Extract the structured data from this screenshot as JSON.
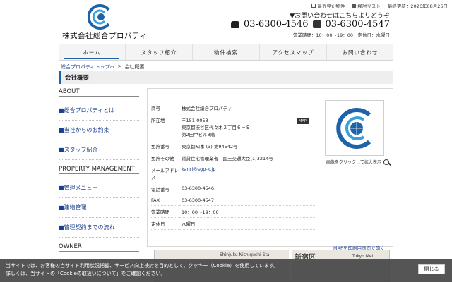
{
  "header": {
    "site_name": "株式会社総合プロパティ",
    "recent_label": "最近見た物件",
    "compare_label": "検討リスト",
    "updated_label": "最終更新：2026年08月26日",
    "inquiry_text": "▼お問い合わせはこちらよりどうぞ",
    "tel": "03-6300-4546",
    "fax": "03-6300-4547",
    "hours_text": "営業時間：10：00〜19：00　定休日：水曜日"
  },
  "nav": {
    "items": [
      "ホーム",
      "スタッフ紹介",
      "物件検索",
      "アクセスマップ",
      "お問い合わせ"
    ]
  },
  "breadcrumb": {
    "top": "総合プロパティトップへ",
    "sep": ">",
    "current": "会社概要"
  },
  "page_title": "会社概要",
  "sidebar": {
    "about_head": "ABOUT",
    "about_items": [
      "■総合プロパティとは",
      "■当社からのお約束",
      "■スタッフ紹介"
    ],
    "pm_head": "PROPERTY MANAGEMENT",
    "pm_items": [
      "■管理メニュー",
      "■建物管理",
      "■管理契約までの流れ"
    ],
    "owner_head": "OWNER"
  },
  "company": {
    "rows": [
      {
        "k": "商号",
        "v": "株式会社総合プロパティ"
      },
      {
        "k": "所在地",
        "v": "〒151-0053\n東京都渋谷区代々木２丁目６－９\n第2田中ビル3階"
      },
      {
        "k": "免許番号",
        "v": "東京都知事 (3) 第94542号"
      },
      {
        "k": "免許その他",
        "v": "賃貸住宅管理業者　国土交通大臣(1)3214号"
      },
      {
        "k": "メールアドレス",
        "v": "kanri@sgp-k.jp"
      },
      {
        "k": "電話番号",
        "v": "03-6300-4546"
      },
      {
        "k": "FAX",
        "v": "03-6300-4547"
      },
      {
        "k": "営業時間",
        "v": "10：00〜19：00"
      },
      {
        "k": "定休日",
        "v": "水曜日"
      }
    ],
    "map_badge": "MAP",
    "photo_caption": "画像をクリックして拡大表示",
    "map_print": "MAPを印刷用画面で開く"
  },
  "map": {
    "station": "Shinjuku Nishiguchi Sta.",
    "area": "新宿区",
    "tokyo": "Tokyo Met..."
  },
  "cookie": {
    "line1": "当サイトでは、お客様の当サイト利用状況把握、サービス向上検討を目的として、クッキー（Cookie）を使用しています。",
    "line2_pre": "詳しくは、当サイトの",
    "line2_link": "「Cookieの取扱いについて」",
    "line2_post": "をご確認ください。",
    "close_label": "閉じる"
  },
  "colors": {
    "accent": "#1e62a8",
    "link": "#1a3f8c",
    "cookie_bg": "#464646"
  }
}
